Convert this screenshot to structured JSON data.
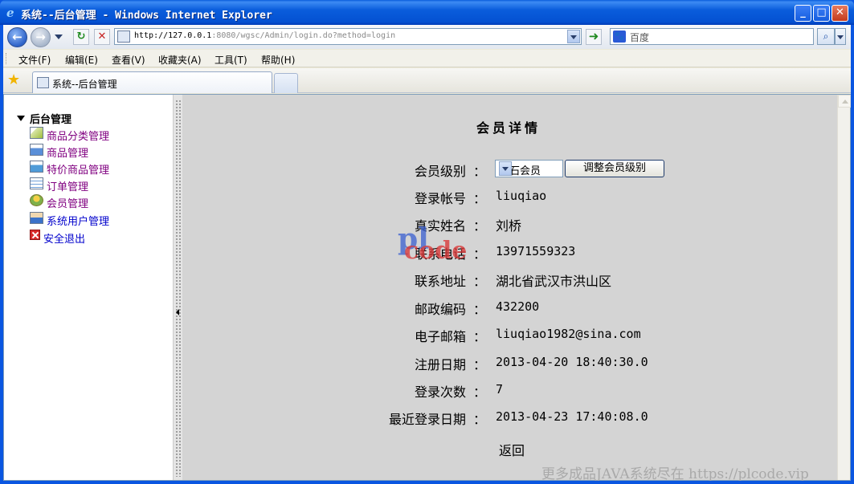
{
  "window": {
    "title": "系统--后台管理 - Windows Internet Explorer",
    "controls": {
      "minimize": "_",
      "maximize": "□",
      "close": "✕"
    }
  },
  "navbar": {
    "back": "←",
    "forward": "→",
    "refresh": "↻",
    "stop": "✕",
    "address_host": "http://127.0.0.1",
    "address_rest": ":8080/wgsc/Admin/login.do?method=login",
    "go": "➜",
    "search_placeholder": "百度",
    "search_button": "⌕"
  },
  "menubar": {
    "items": [
      "文件(F)",
      "编辑(E)",
      "查看(V)",
      "收藏夹(A)",
      "工具(T)",
      "帮助(H)"
    ]
  },
  "tabbar": {
    "favorites_star": "★",
    "active_tab": "系统--后台管理"
  },
  "sidebar": {
    "root_label": "后台管理",
    "items": [
      {
        "label": "商品分类管理",
        "icon": "category-icon"
      },
      {
        "label": "商品管理",
        "icon": "product-icon"
      },
      {
        "label": "特价商品管理",
        "icon": "special-product-icon"
      },
      {
        "label": "订单管理",
        "icon": "order-icon"
      },
      {
        "label": "会员管理",
        "icon": "member-icon"
      },
      {
        "label": "系统用户管理",
        "icon": "system-user-icon"
      },
      {
        "label": "安全退出",
        "icon": "logout-icon"
      }
    ]
  },
  "main": {
    "title": "会员详情",
    "colon": "：",
    "level": {
      "label": "会员级别",
      "selected": "钻石会员",
      "adjust_button": "调整会员级别"
    },
    "fields": [
      {
        "label": "登录帐号",
        "value": "liuqiao"
      },
      {
        "label": "真实姓名",
        "value": "刘桥"
      },
      {
        "label": "联系电话",
        "value": "13971559323"
      },
      {
        "label": "联系地址",
        "value": "湖北省武汉市洪山区"
      },
      {
        "label": "邮政编码",
        "value": "432200"
      },
      {
        "label": "电子邮箱",
        "value": "liuqiao1982@sina.com"
      },
      {
        "label": "注册日期",
        "value": "2013-04-20 18:40:30.0"
      },
      {
        "label": "登录次数",
        "value": "7"
      },
      {
        "label": "最近登录日期",
        "value": "2013-04-23 17:40:08.0"
      }
    ],
    "back_link": "返回"
  },
  "watermark": {
    "logo_top": "pl",
    "logo_bottom": "code",
    "text": "更多成品JAVA系统尽在 https://plcode.vip"
  }
}
